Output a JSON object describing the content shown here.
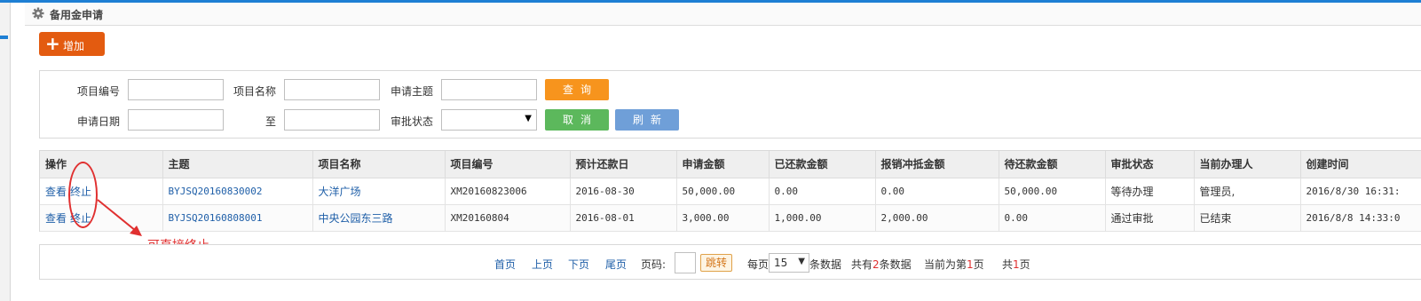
{
  "header": {
    "title": "备用金申请"
  },
  "toolbar": {
    "add_label": "增加"
  },
  "search": {
    "project_no_label": "项目编号",
    "project_name_label": "项目名称",
    "subject_label": "申请主题",
    "apply_date_label": "申请日期",
    "to_label": "至",
    "status_label": "审批状态",
    "query_label": "查询",
    "cancel_label": "取消",
    "refresh_label": "刷新"
  },
  "table": {
    "columns": [
      "操作",
      "主题",
      "项目名称",
      "项目编号",
      "预计还款日",
      "申请金额",
      "已还款金额",
      "报销冲抵金额",
      "待还款金额",
      "审批状态",
      "当前办理人",
      "创建时间"
    ],
    "rows": [
      {
        "view": "查看",
        "stop": "终止",
        "subject": "BYJSQ20160830002",
        "project_name": "大洋广场",
        "project_no": "XM20160823006",
        "repay_date": "2016-08-30",
        "amount": "50,000.00",
        "repaid": "0.00",
        "offset": "0.00",
        "pending": "50,000.00",
        "status": "等待办理",
        "handler": "管理员,",
        "created": "2016/8/30 16:31:"
      },
      {
        "view": "查看",
        "stop": "终止",
        "subject": "BYJSQ20160808001",
        "project_name": "中央公园东三路",
        "project_no": "XM20160804",
        "repay_date": "2016-08-01",
        "amount": "3,000.00",
        "repaid": "1,000.00",
        "offset": "2,000.00",
        "pending": "0.00",
        "status": "通过审批",
        "handler": "已结束",
        "created": "2016/8/8 14:33:0"
      }
    ]
  },
  "annotation": {
    "text": "可直接终止",
    "color": "#e03030"
  },
  "pager": {
    "first": "首页",
    "prev": "上页",
    "next": "下页",
    "last": "尾页",
    "page_label": "页码:",
    "jump": "跳转",
    "per_page_prefix": "每页",
    "per_page_value": "15",
    "per_page_suffix": "条数据",
    "total_prefix": "共有",
    "total_count": "2",
    "total_suffix": "条数据",
    "current_prefix": "当前为第",
    "current_page": "1",
    "current_suffix": "页",
    "pages_prefix": "共",
    "pages_count": "1",
    "pages_suffix": "页"
  },
  "colors": {
    "accent": "#1e7fd4",
    "add": "#e35b10",
    "query": "#f7941d",
    "cancel": "#5cb85c",
    "refresh": "#6f9fd8",
    "link": "#1f5fa8"
  }
}
